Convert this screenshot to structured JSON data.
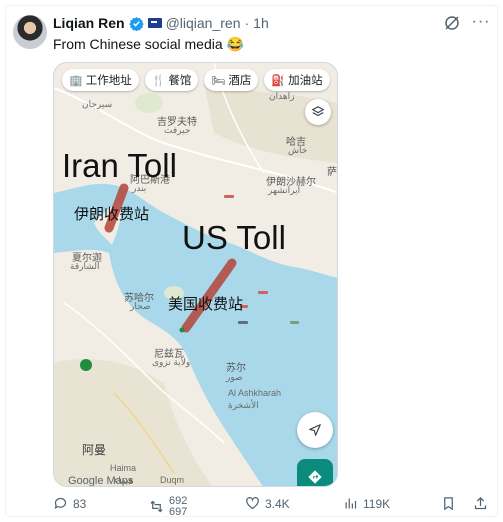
{
  "author": {
    "name": "Liqian Ren",
    "handle": "@liqian_ren",
    "separator": "·",
    "time": "1h"
  },
  "tweet": {
    "text": "From Chinese social media 😂"
  },
  "map": {
    "chips": [
      {
        "icon": "briefcase-icon",
        "glyph": "🏢",
        "label": "工作地址"
      },
      {
        "icon": "restaurant-icon",
        "glyph": "🍴",
        "label": "餐馆"
      },
      {
        "icon": "hotel-icon",
        "glyph": "🛏",
        "label": "酒店"
      },
      {
        "icon": "gas-station-icon",
        "glyph": "⛽",
        "label": "加油站"
      }
    ],
    "overlays": {
      "iran_toll": "Iran Toll",
      "iran_toll_cn": "伊朗收费站",
      "us_toll": "US Toll",
      "us_toll_cn": "美国收费站"
    },
    "places": {
      "bushehr_ar": "سيرجان",
      "jiroft_cn": "吉罗夫特",
      "jiroft_ar": "جيرفت",
      "zahedan_ar": "زاهدان",
      "haji_cn": "哈吉",
      "haji_ar": "خاش",
      "bandar_cn": "阿巴斯港",
      "bandar_ar": "بندر",
      "iranshahr_cn": "伊朗沙赫尔",
      "iranshahr_ar": "ایرانشهر",
      "chabahar_cn": "萨",
      "dubai_cn": "夏尔迦",
      "dubai_ar": "الشارقة",
      "sohar_cn": "苏哈尔",
      "sohar_ar": "صحار",
      "nizwa_cn": "尼兹瓦",
      "nizwa_ar": "ولاية نزوى",
      "sur_cn": "苏尔",
      "sur_ar": "صور",
      "ashkharah_en": "Al Ashkharah",
      "ashkharah_ar": "الأشخرة",
      "oman_cn": "阿曼",
      "haima_en": "Haima",
      "haima_ar": "هيماء",
      "google_maps": "Google Maps",
      "duqm": "Duqm"
    }
  },
  "actions": {
    "replies": "83",
    "reposts_top": "692",
    "reposts_bottom": "697",
    "likes": "3.4K",
    "views": "119K"
  },
  "colors": {
    "accent": "#1d9bf0",
    "muted": "#536471",
    "sea": "#a8d8ea",
    "land": "#f1ede4",
    "route": "#c0392b"
  }
}
